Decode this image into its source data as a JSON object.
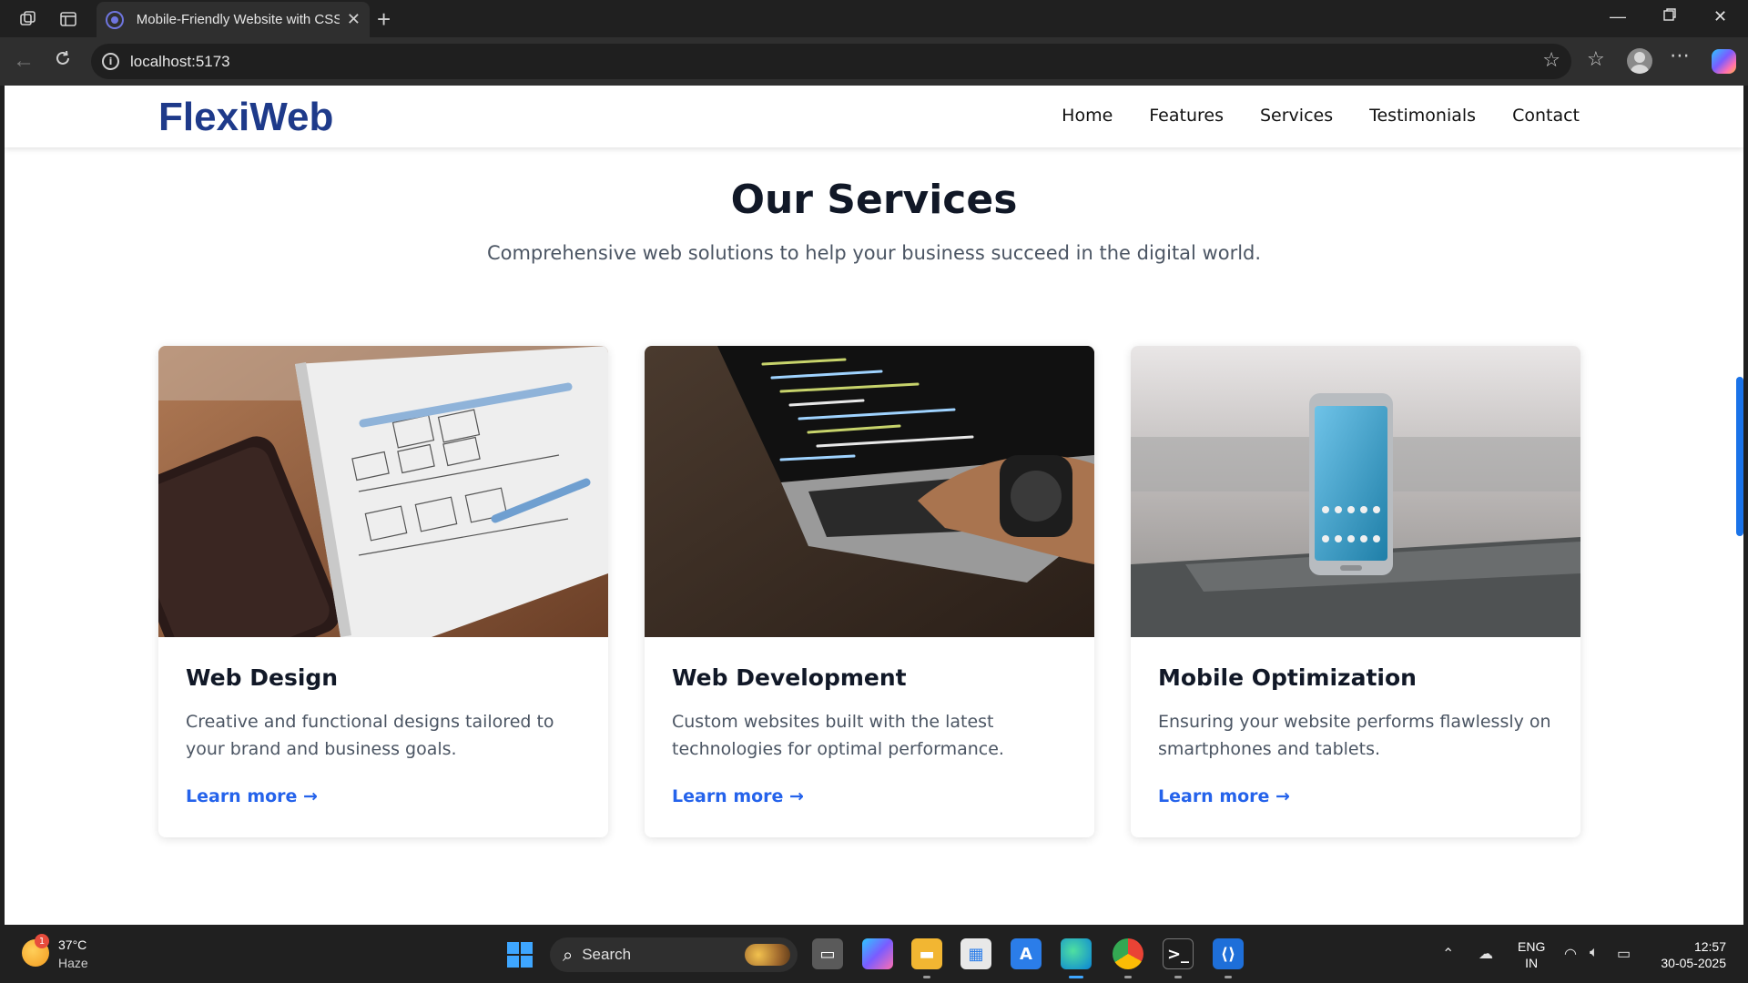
{
  "browser": {
    "tab_title": "Mobile-Friendly Website with CSS",
    "url": "localhost:5173"
  },
  "site": {
    "logo": "FlexiWeb",
    "nav": [
      "Home",
      "Features",
      "Services",
      "Testimonials",
      "Contact"
    ],
    "section_title": "Our Services",
    "section_subtitle": "Comprehensive web solutions to help your business succeed in the digital world.",
    "cards": [
      {
        "image": "wireframe-notebook-photo",
        "title": "Web Design",
        "description": "Creative and functional designs tailored to your brand and business goals.",
        "link": "Learn more →"
      },
      {
        "image": "laptop-coding-photo",
        "title": "Web Development",
        "description": "Custom websites built with the latest technologies for optimal performance.",
        "link": "Learn more →"
      },
      {
        "image": "smartphone-on-bench-photo",
        "title": "Mobile Optimization",
        "description": "Ensuring your website performs flawlessly on smartphones and tablets.",
        "link": "Learn more →"
      }
    ]
  },
  "taskbar": {
    "weather_temp": "37°C",
    "weather_condition": "Haze",
    "weather_badge": "1",
    "search_placeholder": "Search",
    "lang_line1": "ENG",
    "lang_line2": "IN",
    "time": "12:57",
    "date": "30-05-2025"
  },
  "colors": {
    "logo": "#1e3a8a",
    "link": "#2563eb",
    "scrollbar": "#1a73e8"
  }
}
